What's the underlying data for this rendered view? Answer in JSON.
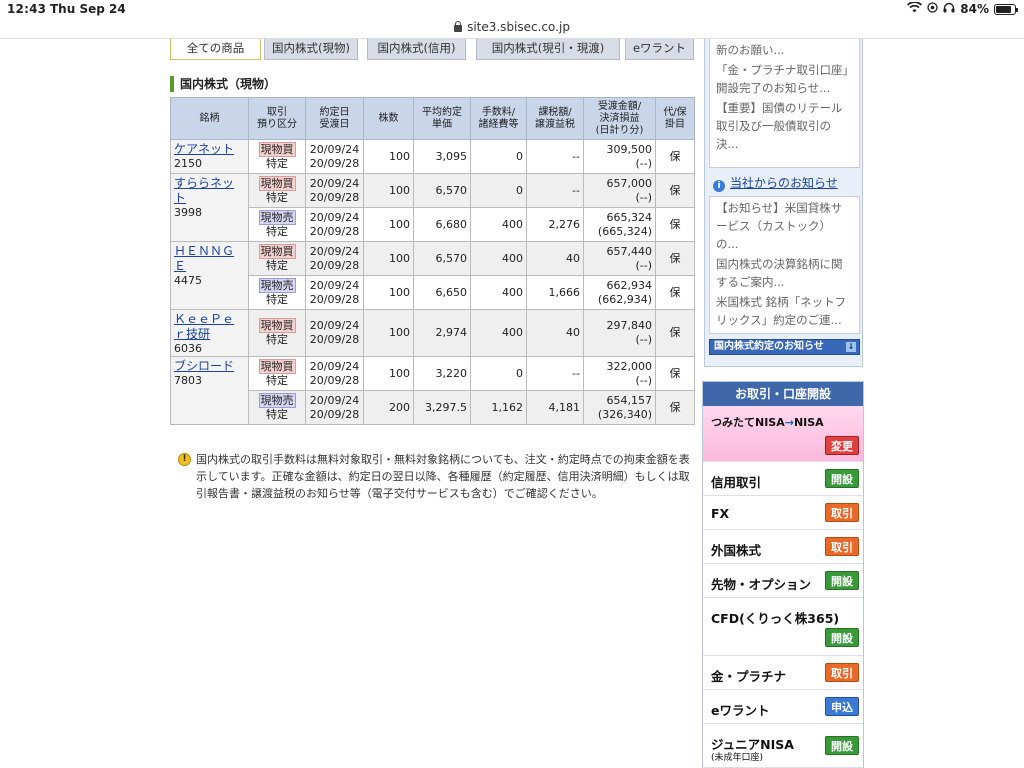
{
  "status": {
    "time": "12:43",
    "date": "Thu Sep 24",
    "battery": "84%",
    "battery_level": 0.84
  },
  "url": "site3.sbisec.co.jp",
  "tabs": [
    "全ての商品",
    "国内株式(現物)",
    "国内株式(信用)",
    "国内株式(現引・現渡)",
    "eワラント"
  ],
  "section_title": "国内株式（現物）",
  "table": {
    "headers": [
      "銘柄",
      "取引\n預り区分",
      "約定日\n受渡日",
      "株数",
      "平均約定\n単価",
      "手数料/\n諸経費等",
      "課税額/\n譲渡益税",
      "受渡金額/\n決済損益\n(日計り分)",
      "代/保\n掛目"
    ],
    "groups": [
      {
        "name": "ケアネット",
        "code": "2150",
        "rows": [
          {
            "type": "現物買",
            "acct": "特定",
            "trade_date": "20/09/24",
            "settle_date": "20/09/28",
            "qty": "100",
            "price": "3,095",
            "fee": "0",
            "tax": "--",
            "amount": "309,500",
            "pl": "(--)",
            "hold": "保"
          }
        ]
      },
      {
        "name": "すららネット",
        "code": "3998",
        "rows": [
          {
            "type": "現物買",
            "acct": "特定",
            "trade_date": "20/09/24",
            "settle_date": "20/09/28",
            "qty": "100",
            "price": "6,570",
            "fee": "0",
            "tax": "--",
            "amount": "657,000",
            "pl": "(--)",
            "hold": "保"
          },
          {
            "type": "現物売",
            "acct": "特定",
            "trade_date": "20/09/24",
            "settle_date": "20/09/28",
            "qty": "100",
            "price": "6,680",
            "fee": "400",
            "tax": "2,276",
            "amount": "665,324",
            "pl": "(665,324)",
            "hold": "保"
          }
        ]
      },
      {
        "name": "ＨＥＮＮＧＥ",
        "code": "4475",
        "rows": [
          {
            "type": "現物買",
            "acct": "特定",
            "trade_date": "20/09/24",
            "settle_date": "20/09/28",
            "qty": "100",
            "price": "6,570",
            "fee": "400",
            "tax": "40",
            "amount": "657,440",
            "pl": "(--)",
            "hold": "保"
          },
          {
            "type": "現物売",
            "acct": "特定",
            "trade_date": "20/09/24",
            "settle_date": "20/09/28",
            "qty": "100",
            "price": "6,650",
            "fee": "400",
            "tax": "1,666",
            "amount": "662,934",
            "pl": "(662,934)",
            "hold": "保"
          }
        ]
      },
      {
        "name": "ＫｅｅＰｅｒ技研",
        "code": "6036",
        "rows": [
          {
            "type": "現物買",
            "acct": "特定",
            "trade_date": "20/09/24",
            "settle_date": "20/09/28",
            "qty": "100",
            "price": "2,974",
            "fee": "400",
            "tax": "40",
            "amount": "297,840",
            "pl": "(--)",
            "hold": "保"
          }
        ]
      },
      {
        "name": "ブシロード",
        "code": "7803",
        "rows": [
          {
            "type": "現物買",
            "acct": "特定",
            "trade_date": "20/09/24",
            "settle_date": "20/09/28",
            "qty": "100",
            "price": "3,220",
            "fee": "0",
            "tax": "--",
            "amount": "322,000",
            "pl": "(--)",
            "hold": "保"
          },
          {
            "type": "現物売",
            "acct": "特定",
            "trade_date": "20/09/24",
            "settle_date": "20/09/28",
            "qty": "200",
            "price": "3,297.5",
            "fee": "1,162",
            "tax": "4,181",
            "amount": "654,157",
            "pl": "(326,340)",
            "hold": "保"
          }
        ]
      }
    ]
  },
  "notice": "国内株式の取引手数料は無料対象取引・無料対象銘柄についても、注文・約定時点での拘束金額を表示しています。正確な金額は、約定日の翌日以降、各種履歴（約定履歴、信用決済明細）もしくは取引報告書・譲渡益税のお知らせ等（電子交付サービスも含む）でご確認ください。",
  "right_panel": {
    "top_news": [
      "新のお願い...",
      "「金・プラチナ取引口座」開設完了のお知らせ...",
      "【重要】国債のリテール取引及び一般債取引の決..."
    ],
    "news_header": "当社からのお知らせ",
    "news": [
      "【お知らせ】米国貸株サービス（カストック）の...",
      "国内株式の決算銘柄に関するご案内...",
      "米国株式 銘柄「ネットフリックス」約定のご連..."
    ],
    "banner": "国内株式約定のお知らせ",
    "account_header": "お取引・口座開設",
    "nisa": {
      "prefix": "つみたてNISA",
      "arrow": "→",
      "suffix": "NISA",
      "button": "変更"
    },
    "items": [
      {
        "label": "信用取引",
        "button": "開設",
        "style": "green"
      },
      {
        "label": "FX",
        "button": "取引",
        "style": "red"
      },
      {
        "label": "外国株式",
        "button": "取引",
        "style": "red"
      },
      {
        "label": "先物・オプション",
        "button": "開設",
        "style": "green"
      },
      {
        "label": "CFD(くりっく株365)",
        "button": "開設",
        "style": "green"
      },
      {
        "label": "金・プラチナ",
        "button": "取引",
        "style": "red"
      },
      {
        "label": "eワラント",
        "button": "申込",
        "style": "blue"
      },
      {
        "label": "ジュニアNISA",
        "sub": "(未成年口座)",
        "button": "開設",
        "style": "green"
      }
    ]
  }
}
